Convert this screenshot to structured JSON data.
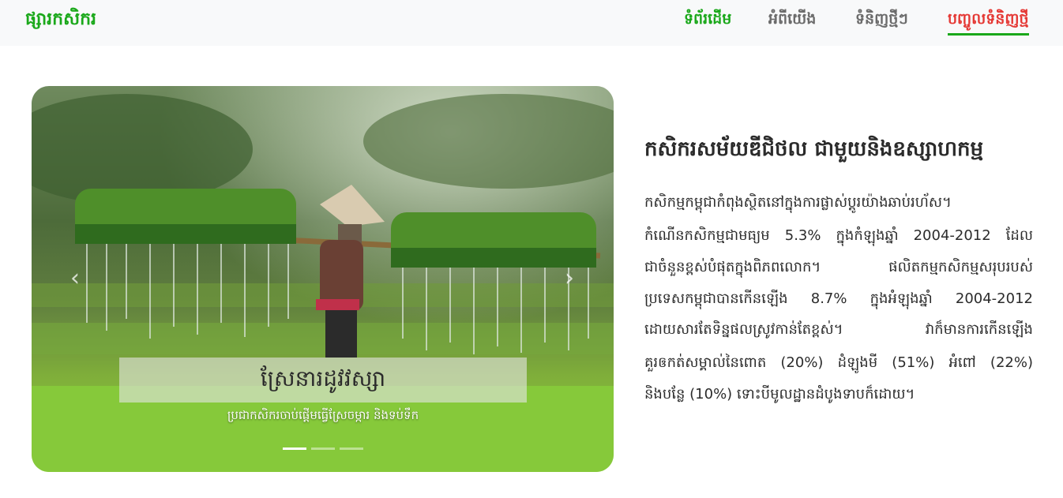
{
  "navbar": {
    "brand": "ផ្សារកសិករ",
    "links": [
      {
        "label": "ទំព័រដើម"
      },
      {
        "label": "អំពីយើង"
      },
      {
        "label": "ទំនិញថ្មីៗ"
      },
      {
        "label": "បញ្ចូលទំនិញថ្មី"
      }
    ],
    "colors": {
      "active": "#1aa81a",
      "muted": "#6b6b6b",
      "highlight": "#e53935"
    }
  },
  "carousel": {
    "prev_icon": "chevron-left-icon",
    "next_icon": "chevron-right-icon",
    "prev_glyph": "‹",
    "next_glyph": "›",
    "caption_title": "ស្រែនារដូវវស្សា",
    "caption_text": "ប្រជាកសិករចាប់ផ្ដើមធ្វើស្រែចម្ការ និងទប់ទឹក",
    "slide_count": 3,
    "active_slide": 1
  },
  "article": {
    "title": "កសិករសម័យឌីជិថល ជាមួយនិងឧស្សាហកម្ម",
    "lines": [
      "កសិកម្មកម្ពុជាកំពុងស្ថិតនៅក្នុងការផ្លាស់ប្តូរយ៉ាងឆាប់រហ័ស។",
      "កំណើនកសិកម្មជាមធ្យម 5.3% ក្នុងកំឡុងឆ្នាំ 2004-2012 ដែល",
      "ជាចំនួនខ្ពស់បំផុតក្នុងពិភពលោក។ ផលិតកម្មកសិកម្មសរុបរបស់",
      "ប្រទេសកម្ពុជាបានកើនឡើង 8.7% ក្នុងអំឡុងឆ្នាំ 2004-2012",
      "ដោយសារតែទិន្នផលស្រូវកាន់តែខ្ពស់។ វាក៏មានការកើនឡើង",
      "គួរឲកត់សម្គាល់នៃពោត (20%) ដំឡូងមី (51%) អំពៅ (22%)",
      "និងបន្លែ (10%) ទោះបីមូលដ្ឋានដំបូងទាបក៏ដោយ។"
    ]
  }
}
